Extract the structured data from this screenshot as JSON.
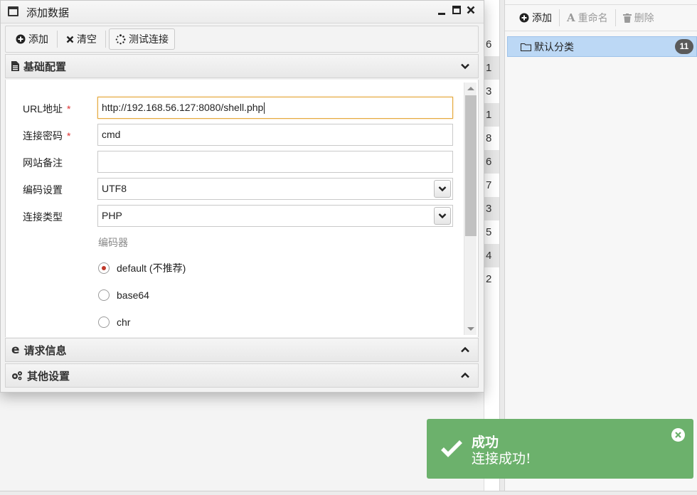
{
  "background": {
    "row_digits": [
      "6",
      "1",
      "3",
      "1",
      "8",
      "6",
      "7",
      "3",
      "5",
      "4",
      "2"
    ]
  },
  "right_panel": {
    "toolbar": {
      "add_label": "添加",
      "rename_label": "重命名",
      "delete_label": "删除"
    },
    "category": {
      "label": "默认分类",
      "count": "11"
    }
  },
  "dialog": {
    "title": "添加数据",
    "toolbar": {
      "add_label": "添加",
      "clear_label": "清空",
      "test_label": "测试连接"
    },
    "sections": {
      "basic": "基础配置",
      "request": "请求信息",
      "other": "其他设置"
    },
    "form": {
      "url_label": "URL地址",
      "url_value": "http://192.168.56.127:8080/shell.php",
      "password_label": "连接密码",
      "password_value": "cmd",
      "note_label": "网站备注",
      "note_value": "",
      "encoding_label": "编码设置",
      "encoding_value": "UTF8",
      "type_label": "连接类型",
      "type_value": "PHP",
      "required_mark": "*",
      "encoder_label": "编码器",
      "encoders": [
        {
          "label": "default (不推荐)",
          "selected": true
        },
        {
          "label": "base64",
          "selected": false
        },
        {
          "label": "chr",
          "selected": false
        }
      ]
    }
  },
  "toast": {
    "title": "成功",
    "message": "连接成功!",
    "color": "#6cb16c"
  }
}
